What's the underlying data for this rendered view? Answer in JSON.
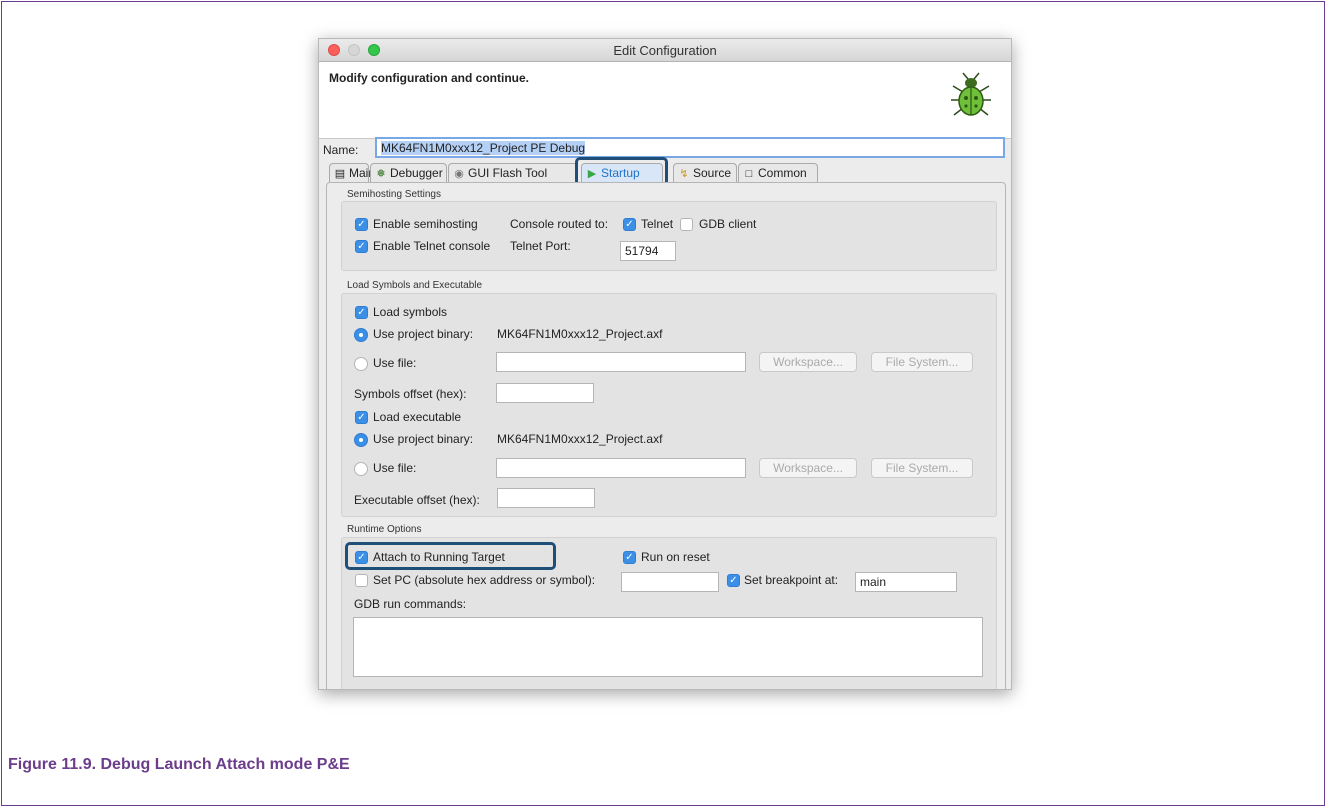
{
  "window": {
    "title": "Edit Configuration",
    "header_message": "Modify configuration and continue."
  },
  "name_field": {
    "label": "Name:",
    "value": "MK64FN1M0xxx12_Project PE Debug"
  },
  "tabs": [
    {
      "label": "Main",
      "icon": "page-icon"
    },
    {
      "label": "Debugger",
      "icon": "gear-icon"
    },
    {
      "label": "GUI Flash Tool",
      "icon": "flash-icon"
    },
    {
      "label": "Startup",
      "icon": "play-icon"
    },
    {
      "label": "Source",
      "icon": "source-icon"
    },
    {
      "label": "Common",
      "icon": "window-icon"
    }
  ],
  "semihosting": {
    "title": "Semihosting Settings",
    "enable_semihosting": "Enable semihosting",
    "console_routed": "Console routed to:",
    "telnet": "Telnet",
    "gdb_client": "GDB client",
    "enable_telnet": "Enable Telnet console",
    "telnet_port_label": "Telnet Port:",
    "telnet_port": "51794"
  },
  "load": {
    "title": "Load Symbols and Executable",
    "load_symbols": "Load symbols",
    "use_project_binary": "Use project binary:",
    "symbols_binary": "MK64FN1M0xxx12_Project.axf",
    "use_file": "Use file:",
    "workspace": "Workspace...",
    "file_system": "File System...",
    "symbols_offset": "Symbols offset (hex):",
    "load_executable": "Load executable",
    "exec_binary": "MK64FN1M0xxx12_Project.axf",
    "exec_offset": "Executable offset (hex):"
  },
  "runtime": {
    "title": "Runtime Options",
    "attach": "Attach to Running Target",
    "run_on_reset": "Run on reset",
    "set_pc": "Set PC (absolute hex address or symbol):",
    "set_breakpoint": "Set breakpoint at:",
    "breakpoint_value": "main",
    "gdb_run_commands": "GDB run commands:"
  },
  "caption": "Figure 11.9. Debug Launch Attach mode P&E",
  "colors": {
    "accent": "#3b8fe6",
    "highlight": "#1f4e79",
    "caption": "#6b3d8c"
  }
}
